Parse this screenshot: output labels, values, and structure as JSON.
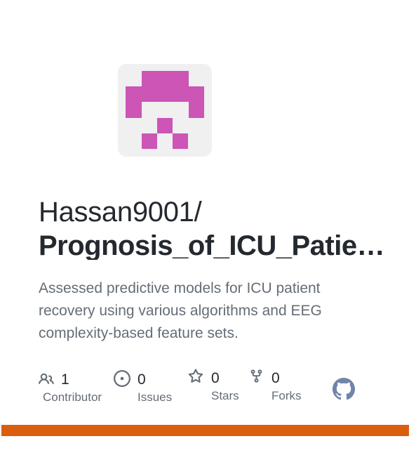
{
  "repo": {
    "owner": "Hassan9001/",
    "name": "Prognosis_of_ICU_Patient_Recovery",
    "description": "Assessed predictive models for ICU patient recovery using various algorithms and EEG complexity-based feature sets."
  },
  "stats": {
    "contributors": {
      "count": "1",
      "label": "Contributor",
      "icon": "people-icon"
    },
    "issues": {
      "count": "0",
      "label": "Issues",
      "icon": "issue-opened-icon"
    },
    "stars": {
      "count": "0",
      "label": "Stars",
      "icon": "star-icon"
    },
    "forks": {
      "count": "0",
      "label": "Forks",
      "icon": "repo-forked-icon"
    }
  },
  "colors": {
    "identicon": "#cc55b6",
    "identicon_bg": "#f0f0f0",
    "accent_bar": "#d95f0e",
    "text_primary": "#24292f",
    "text_secondary": "#656d76"
  },
  "icons": {
    "avatar": "identicon",
    "brand": "github-icon"
  }
}
